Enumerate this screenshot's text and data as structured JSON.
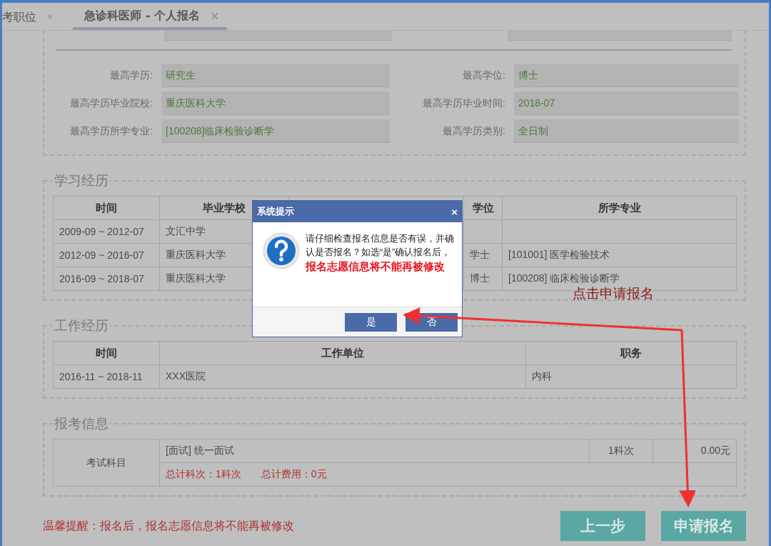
{
  "tabs": [
    {
      "label": "考职位",
      "selected": false,
      "close": "×"
    },
    {
      "label": "急诊科医师 - 个人报名",
      "selected": true,
      "close": "×"
    }
  ],
  "profile": [
    {
      "label": "最高学历:",
      "value": "研究生"
    },
    {
      "label": "最高学位:",
      "value": "博士"
    },
    {
      "label": "最高学历毕业院校:",
      "value": "重庆医科大学"
    },
    {
      "label": "最高学历毕业时间:",
      "value": "2018-07"
    },
    {
      "label": "最高学历所学专业:",
      "value": "[100208]临床检验诊断学"
    },
    {
      "label": "最高学历类别:",
      "value": "全日制"
    }
  ],
  "study": {
    "title": "学习经历",
    "columns": [
      "时间",
      "毕业学校",
      "学位",
      "所学专业"
    ],
    "rows": [
      {
        "time": "2009-09 ~ 2012-07",
        "school": "文汇中学"
      },
      {
        "time": "2012-09 ~ 2016-07",
        "school": "重庆医科大学",
        "degree": "学士",
        "major": "[101001] 医学检验技术"
      },
      {
        "time": "2016-09 ~ 2018-07",
        "school": "重庆医科大学",
        "degree": "博士",
        "major": "[100208] 临床检验诊断学"
      }
    ]
  },
  "work": {
    "title": "工作经历",
    "columns": [
      "时间",
      "工作单位",
      "职务"
    ],
    "rows": [
      {
        "time": "2016-11 ~ 2018-11",
        "unit": "XXX医院",
        "post": "内科"
      }
    ]
  },
  "exam": {
    "title": "报考信息",
    "label": "考试科目",
    "items": [
      {
        "name": "[面试] 统一面试",
        "count": "1科次",
        "fee": "0.00元"
      }
    ],
    "summary": [
      "总计科次：1科次",
      "总计费用：0元"
    ]
  },
  "notice": "温馨提醒：报名后，报名志愿信息将不能再被修改",
  "buttons": [
    {
      "label": "上一步"
    },
    {
      "label": "申请报名"
    }
  ],
  "dialog": {
    "title": "系统提示",
    "close": "×",
    "message": "请仔细检查报名信息是否有误，并确认是否报名？如选“是”确认报名后，",
    "warning": "报名志愿信息将不能再被修改",
    "buttons": [
      {
        "label": "是"
      },
      {
        "label": "否"
      }
    ]
  },
  "annotation": {
    "text": "点击申请报名"
  }
}
